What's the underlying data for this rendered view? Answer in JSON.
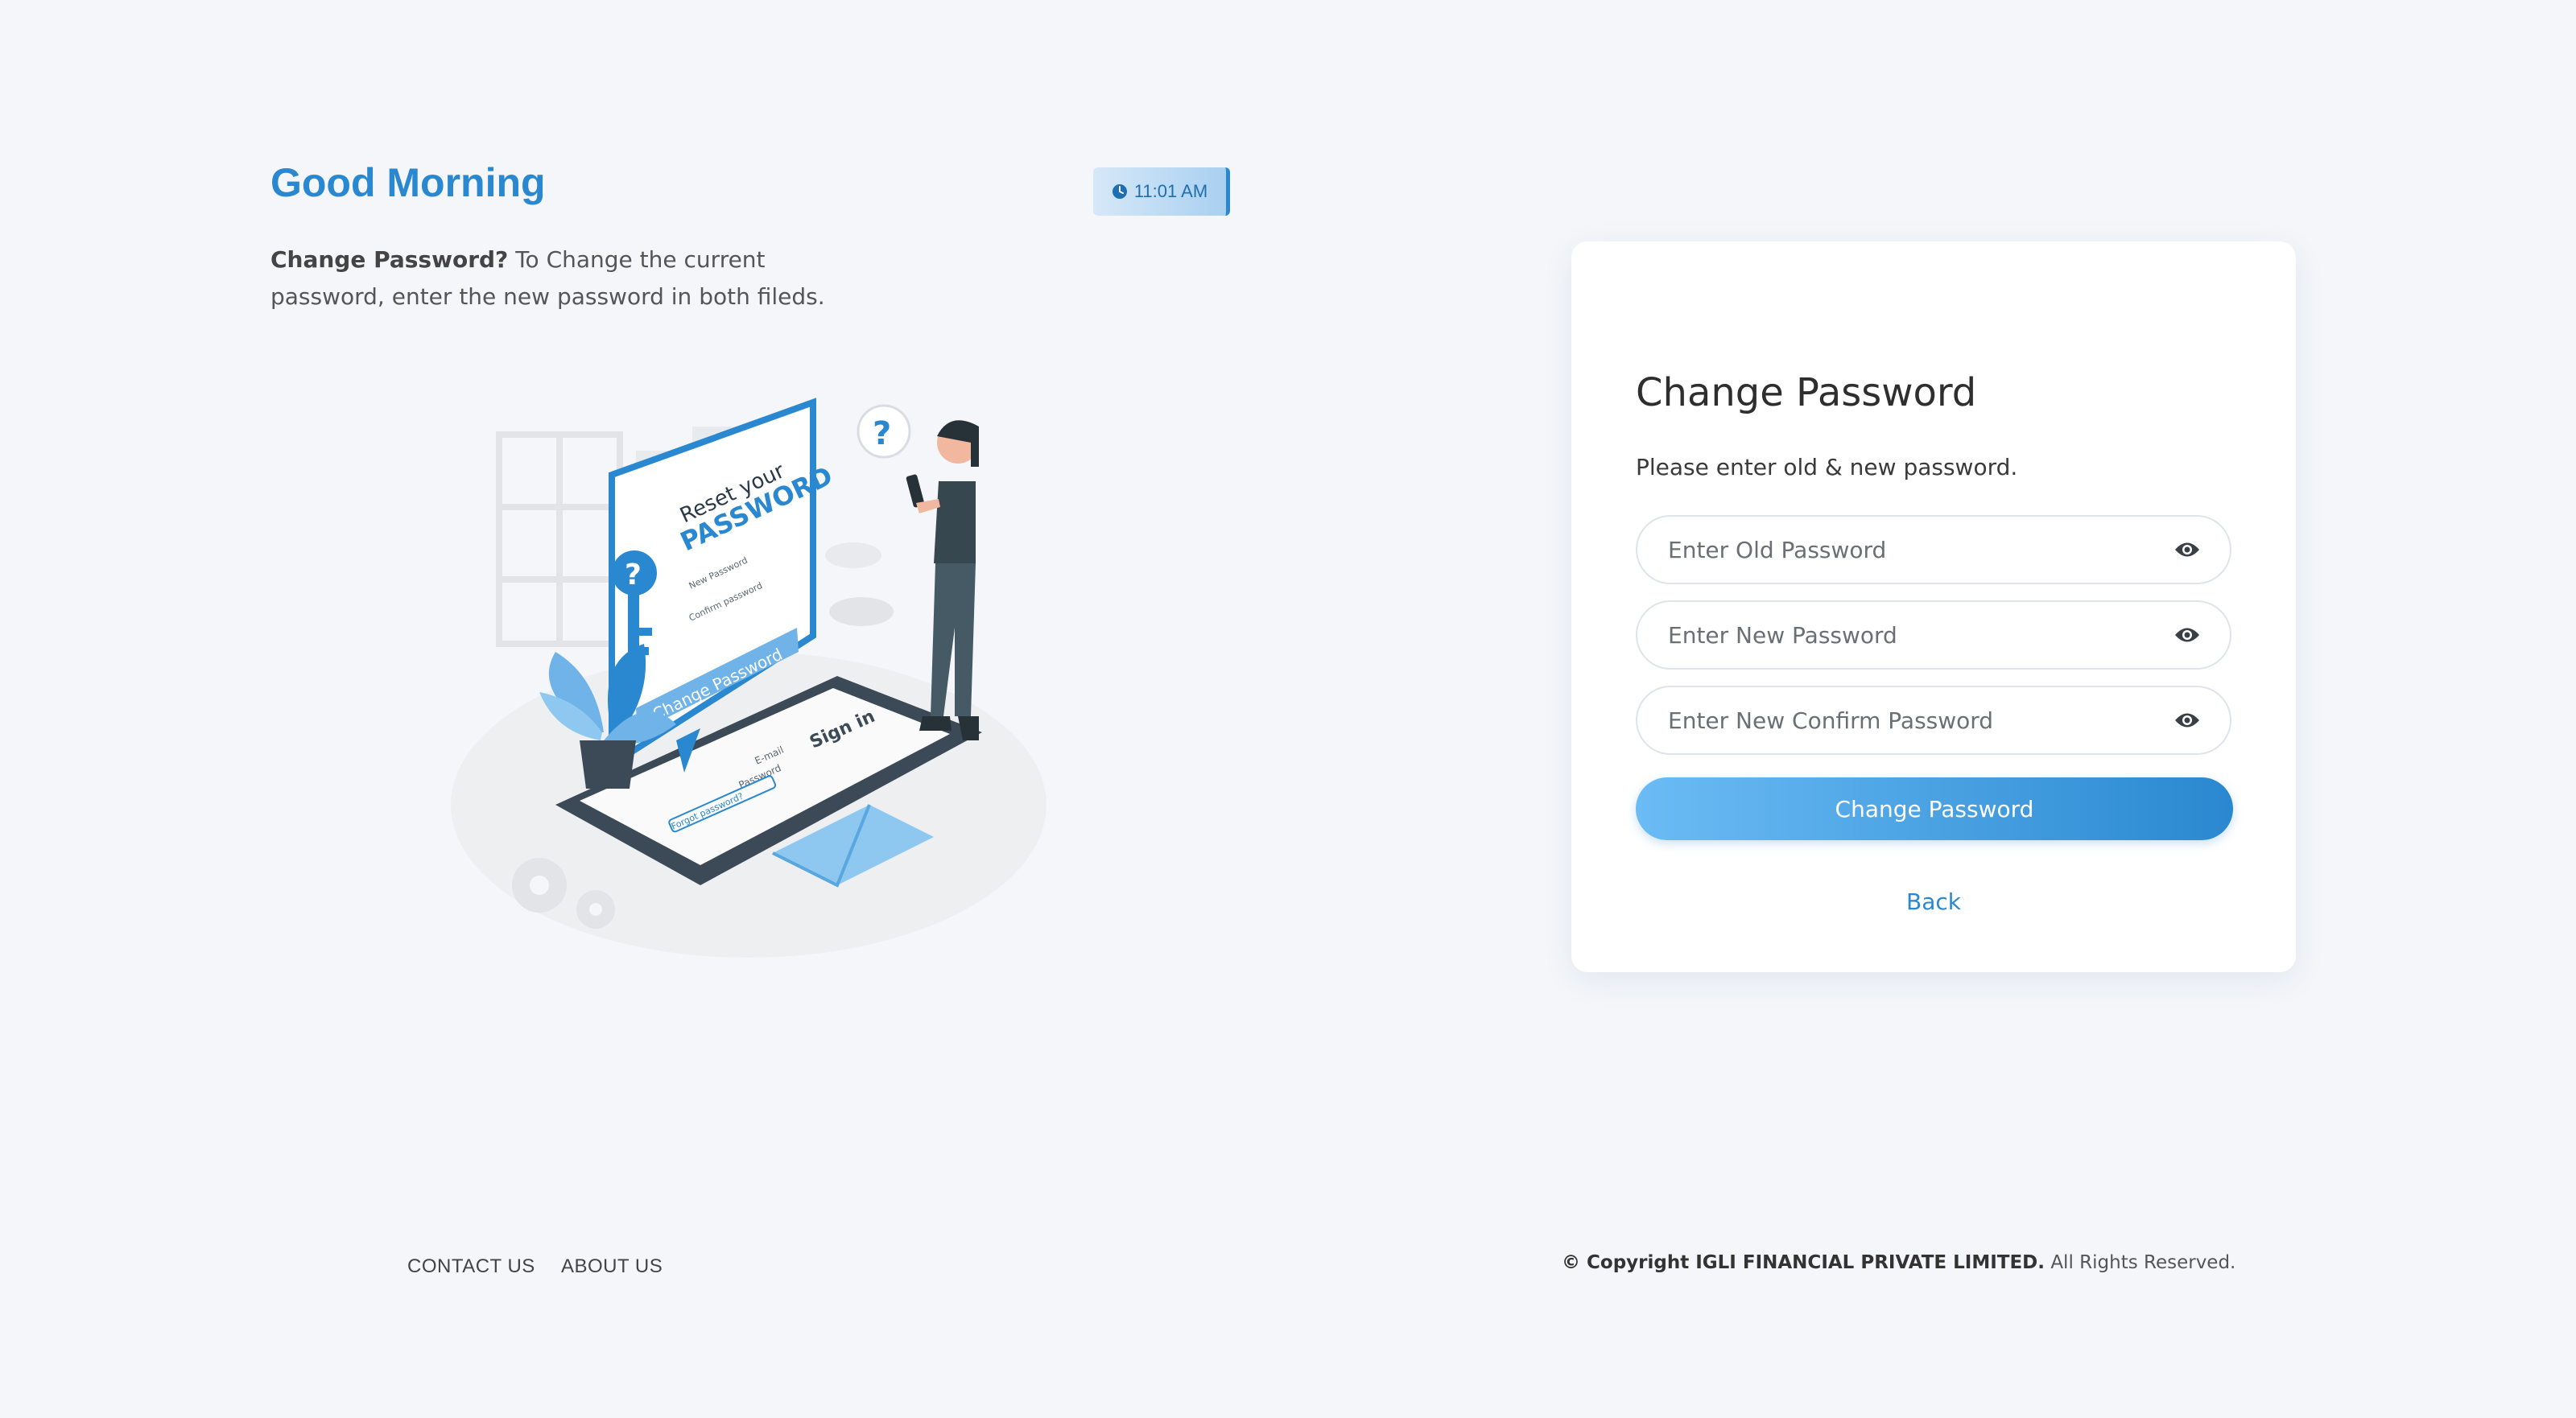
{
  "greeting": "Good Morning",
  "time": "11:01 AM",
  "intro": {
    "bold": "Change Password?",
    "text": " To Change the current password, enter the new password in both fileds."
  },
  "illustration": {
    "panel_line1": "Reset your",
    "panel_line2": "PASSWORD",
    "panel_field1": "New Password",
    "panel_field2": "Confirm password",
    "panel_button": "Change Password",
    "phone_title": "Sign in",
    "phone_field1": "E-mail",
    "phone_field2": "Password",
    "phone_link": "Forgot password?"
  },
  "card": {
    "title": "Change Password",
    "subtitle": "Please enter old & new password.",
    "old_placeholder": "Enter Old Password",
    "new_placeholder": "Enter New Password",
    "confirm_placeholder": "Enter New Confirm Password",
    "submit_label": "Change Password",
    "back_label": "Back"
  },
  "footer": {
    "contact": "CONTACT US",
    "about": "ABOUT US",
    "copyright_bold": "© Copyright IGLI FINANCIAL PRIVATE LIMITED.",
    "copyright_rest": " All Rights Reserved."
  },
  "colors": {
    "accent": "#2a88d0",
    "background": "#f4f6fa"
  }
}
